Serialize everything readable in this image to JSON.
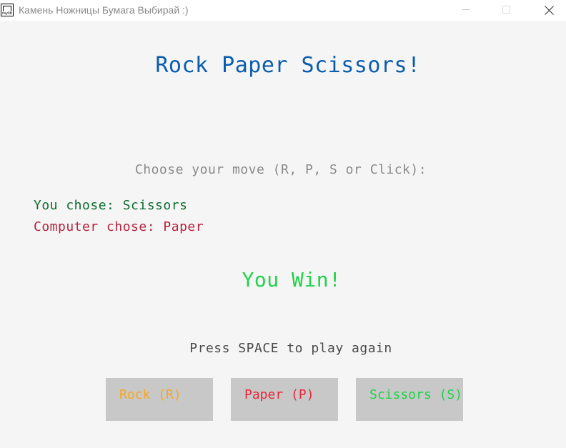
{
  "window": {
    "title": "Камень Ножницы Бумага Выбирай :)",
    "icon_label": "raylib"
  },
  "game": {
    "heading": "Rock Paper Scissors!",
    "prompt": "Choose your move (R, P, S or Click):",
    "player_choice": "You chose: Scissors",
    "computer_choice": "Computer chose: Paper",
    "result": "You Win!",
    "restart_hint": "Press SPACE to play again"
  },
  "buttons": [
    {
      "label": "Rock (R)",
      "color": "#f5a623"
    },
    {
      "label": "Paper (P)",
      "color": "#e8283c"
    },
    {
      "label": "Scissors (S)",
      "color": "#1fd148"
    }
  ],
  "colors": {
    "heading": "#0b5cad",
    "prompt": "#8a8a8a",
    "player_choice": "#0a6b2e",
    "computer_choice": "#b5233e",
    "result": "#22d24a",
    "restart_hint": "#4a4a4a",
    "background": "#f5f5f5",
    "button_bg": "#c8c8c8"
  }
}
